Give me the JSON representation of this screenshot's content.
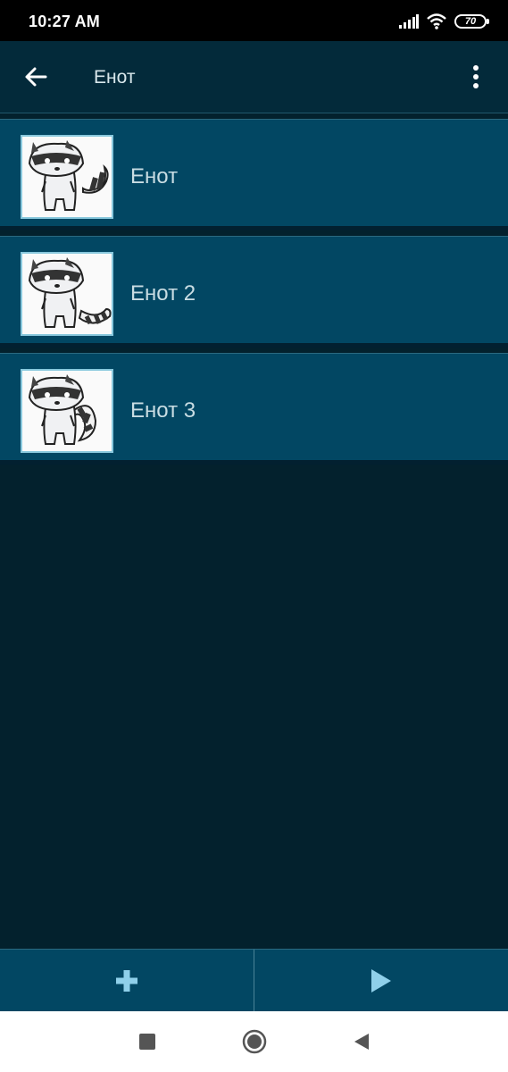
{
  "status_bar": {
    "time": "10:27 AM",
    "battery": "70",
    "icons": [
      "signal-icon",
      "wifi-icon",
      "battery-icon"
    ]
  },
  "app_bar": {
    "title": "Енот",
    "back_icon": "arrow-left-icon",
    "menu_icon": "more-vert-icon"
  },
  "items": [
    {
      "label": "Енот",
      "image": "raccoon-image"
    },
    {
      "label": "Енот 2",
      "image": "raccoon-image"
    },
    {
      "label": "Енот 3",
      "image": "raccoon-image"
    }
  ],
  "bottom_bar": {
    "add_icon": "plus-icon",
    "play_icon": "play-icon"
  },
  "nav_bar": {
    "icons": [
      "recents-square-icon",
      "home-circle-icon",
      "back-triangle-icon"
    ]
  },
  "colors": {
    "background": "#03212d",
    "app_bar": "#032a3a",
    "item": "#024763",
    "accent": "#8fd0ea"
  }
}
